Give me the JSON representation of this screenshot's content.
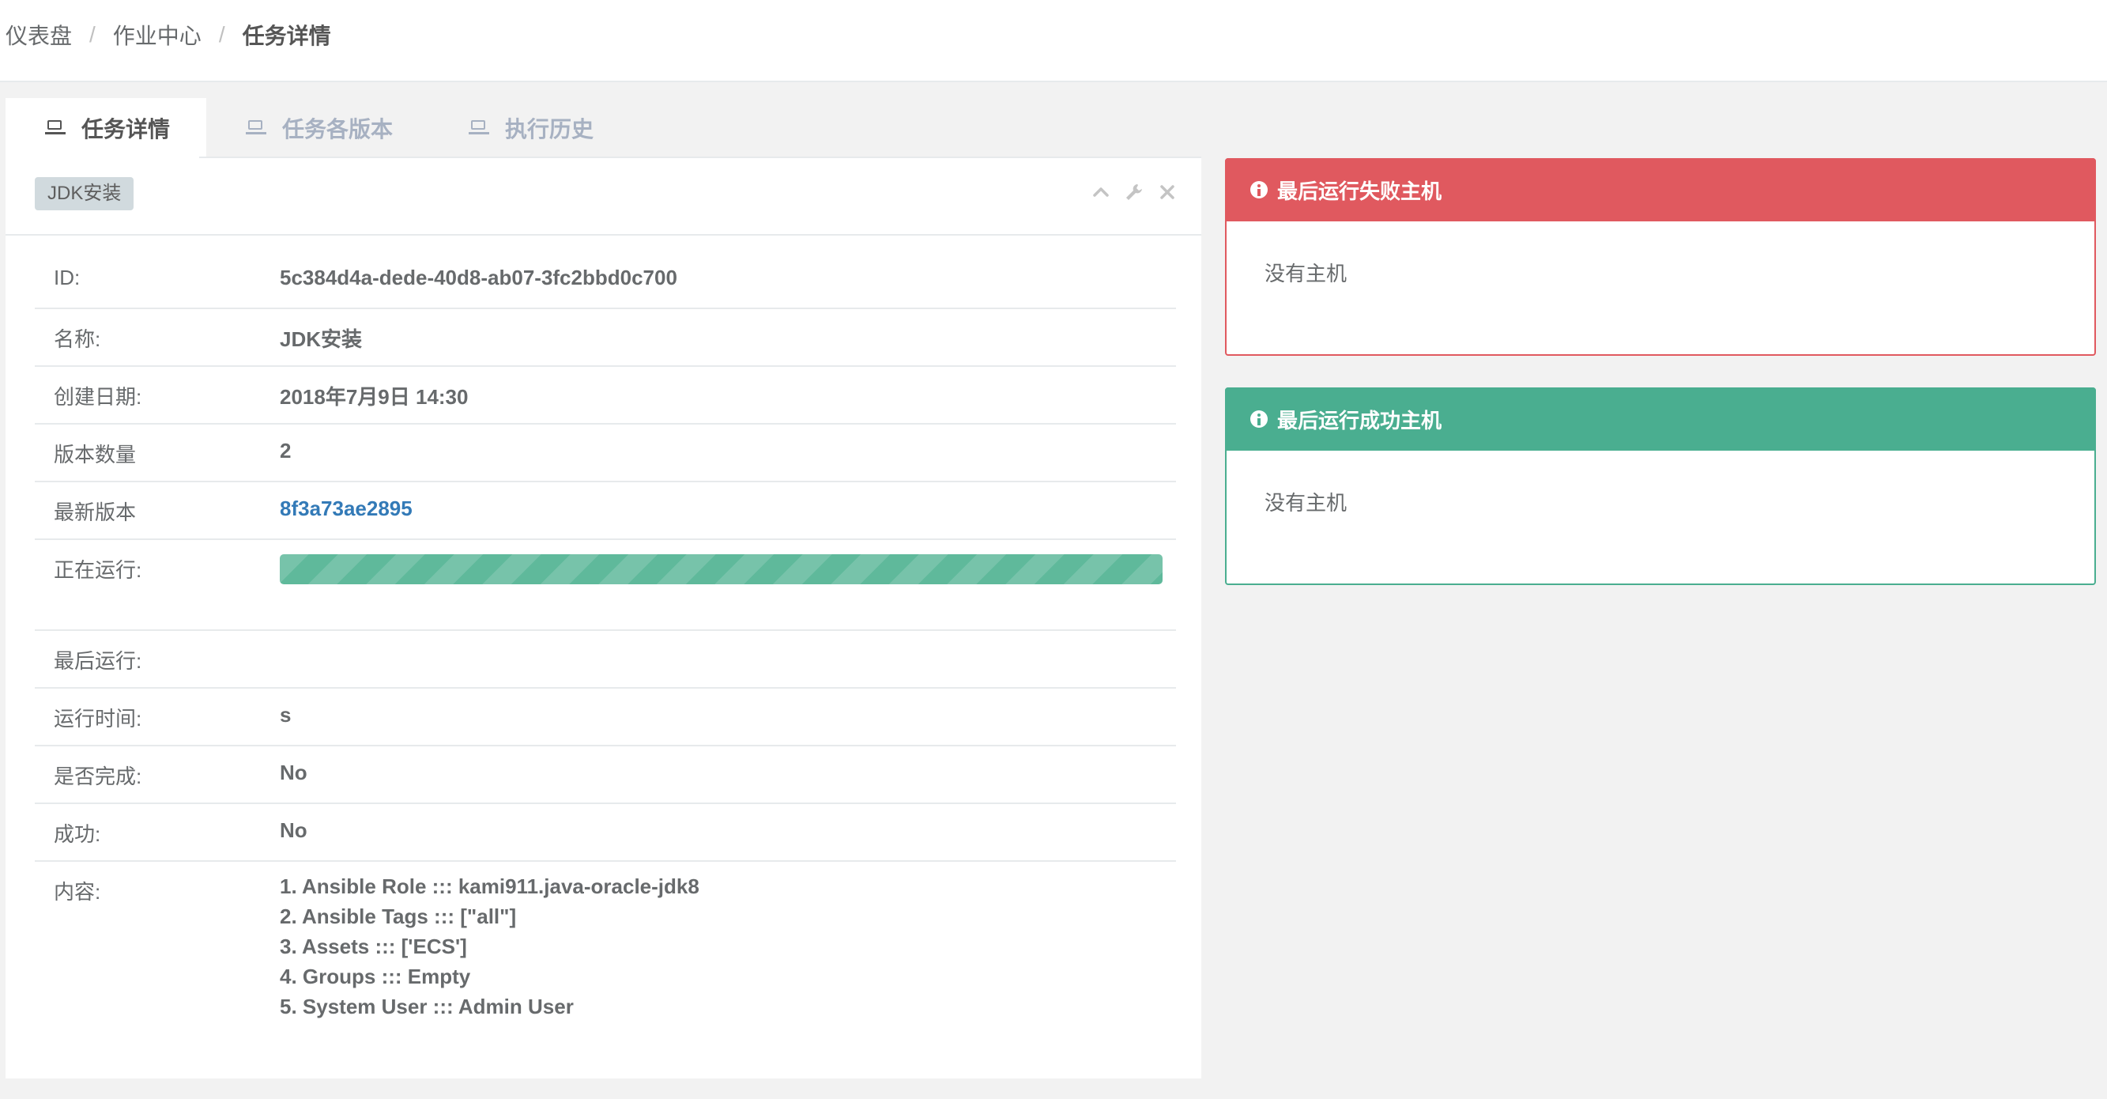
{
  "breadcrumb": {
    "items": [
      "仪表盘",
      "作业中心"
    ],
    "current": "任务详情",
    "separator": "/"
  },
  "tabs": [
    {
      "label": "任务详情",
      "icon": "laptop-icon",
      "active": true
    },
    {
      "label": "任务各版本",
      "icon": "laptop-icon",
      "active": false
    },
    {
      "label": "执行历史",
      "icon": "laptop-icon",
      "active": false
    }
  ],
  "panel": {
    "tag": "JDK安装",
    "tools": [
      "chevron-up-icon",
      "wrench-icon",
      "close-icon"
    ],
    "rows": {
      "id": {
        "label": "ID:",
        "value": "5c384d4a-dede-40d8-ab07-3fc2bbd0c700"
      },
      "name": {
        "label": "名称:",
        "value": "JDK安装"
      },
      "created": {
        "label": "创建日期:",
        "value": "2018年7月9日 14:30"
      },
      "version_count": {
        "label": "版本数量",
        "value": "2"
      },
      "latest_version": {
        "label": "最新版本",
        "value": "8f3a73ae2895"
      },
      "running": {
        "label": "正在运行:",
        "progress_percent": 100
      },
      "last_run": {
        "label": "最后运行:",
        "value": ""
      },
      "run_time": {
        "label": "运行时间:",
        "value": "s"
      },
      "finished": {
        "label": "是否完成:",
        "value": "No"
      },
      "success": {
        "label": "成功:",
        "value": "No"
      },
      "content": {
        "label": "内容:",
        "lines": [
          "1. Ansible Role ::: kami911.java-oracle-jdk8",
          "2. Ansible Tags ::: [\"all\"]",
          "3. Assets ::: ['ECS']",
          "4. Groups ::: Empty",
          "5. System User ::: Admin User"
        ]
      }
    }
  },
  "failed_hosts": {
    "title": "最后运行失败主机",
    "body": "没有主机",
    "color": "#e0595f",
    "icon": "info-icon"
  },
  "success_hosts": {
    "title": "最后运行成功主机",
    "body": "没有主机",
    "color": "#4aae90",
    "icon": "info-icon"
  },
  "colors": {
    "progress": "#1ab394",
    "link": "#337ab7",
    "background": "#f2f2f2"
  }
}
